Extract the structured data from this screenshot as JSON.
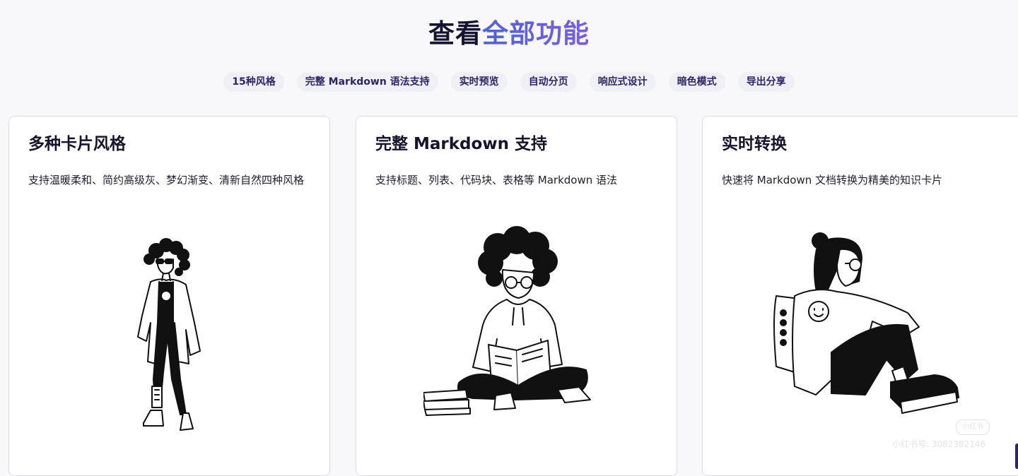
{
  "section": {
    "title_plain": "查看",
    "title_accent": "全部功能"
  },
  "tags": [
    "15种风格",
    "完整 Markdown 语法支持",
    "实时预览",
    "自动分页",
    "响应式设计",
    "暗色模式",
    "导出分享"
  ],
  "cards": [
    {
      "title": "多种卡片风格",
      "description": "支持温暖柔和、简约高级灰、梦幻渐变、清新自然四种风格",
      "illustration": "woman-standing-illustration"
    },
    {
      "title": "完整 Markdown 支持",
      "description": "支持标题、列表、代码块、表格等 Markdown 语法",
      "illustration": "woman-reading-book-illustration"
    },
    {
      "title": "实时转换",
      "description": "快速将 Markdown 文档转换为精美的知识卡片",
      "illustration": "girl-sitting-illustration"
    }
  ],
  "watermark": {
    "badge": "小红书",
    "text": "小红书号: 3082382146"
  },
  "colors": {
    "accent_start": "#4d63d9",
    "accent_end": "#7b5ce4",
    "tag_bg": "#efeff6",
    "tag_text": "#2e2468"
  }
}
